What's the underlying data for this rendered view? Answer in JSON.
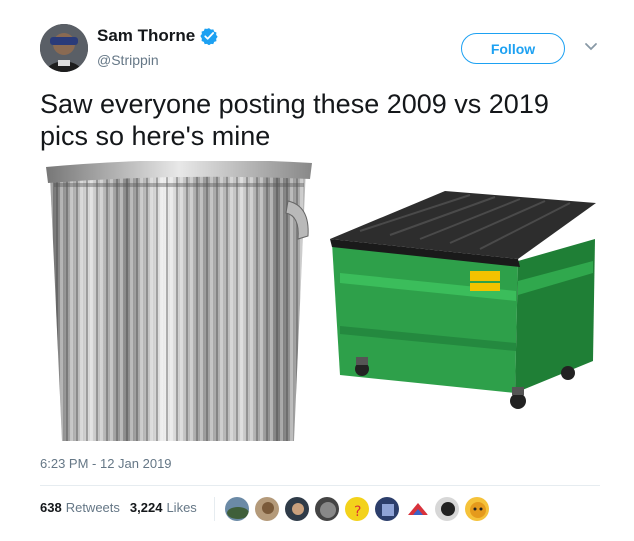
{
  "author": {
    "display_name": "Sam Thorne",
    "handle": "@Strippin",
    "verified": true,
    "avatar_icon": "user-avatar"
  },
  "actions": {
    "follow_label": "Follow",
    "menu_icon": "chevron-down-icon"
  },
  "tweet": {
    "line1": "Saw everyone posting these 2009 vs 2019",
    "line2": "pics so here's mine"
  },
  "media": {
    "left_image": "trash-can",
    "right_image": "green-dumpster",
    "dumpster_color": "#2ea04a",
    "lid_color": "#333333"
  },
  "timestamp": "6:23 PM - 12 Jan 2019",
  "stats": {
    "retweets_count": "638",
    "retweets_label": "Retweets",
    "likes_count": "3,224",
    "likes_label": "Likes"
  },
  "likers": [
    "liker-1",
    "liker-2",
    "liker-3",
    "liker-4",
    "liker-5",
    "liker-6",
    "liker-7",
    "liker-8",
    "liker-9"
  ],
  "colors": {
    "accent": "#1da1f2",
    "muted": "#657786",
    "text": "#14171a"
  }
}
